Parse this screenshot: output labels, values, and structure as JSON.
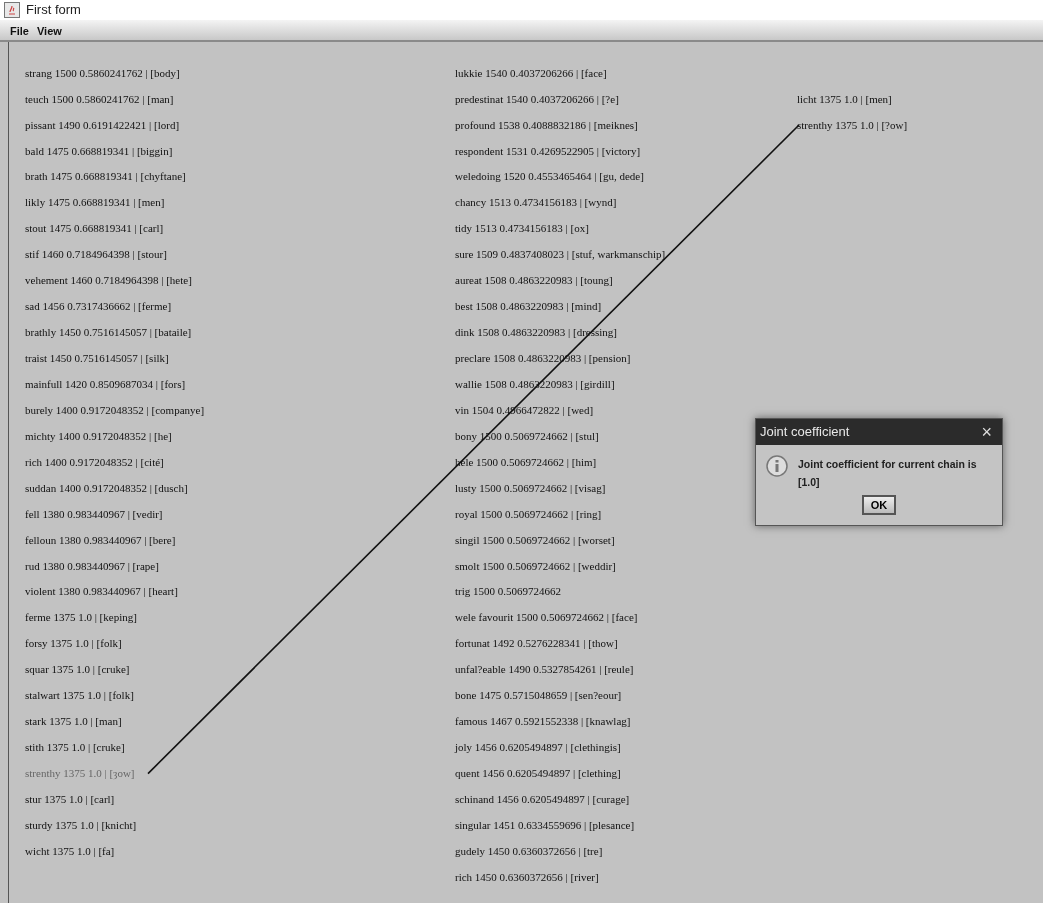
{
  "window": {
    "title": "First form"
  },
  "menu": [
    "File",
    "View"
  ],
  "columns": [
    [
      {
        "text": "strang 1500 0.5860241762 | [body]",
        "highlighted": false,
        "linked": false
      },
      {
        "text": "teuch 1500 0.5860241762 | [man]",
        "highlighted": false,
        "linked": false
      },
      {
        "text": "pissant 1490 0.6191422421 | [lord]",
        "highlighted": false,
        "linked": false
      },
      {
        "text": "bald 1475 0.668819341 | [biggin]",
        "highlighted": false,
        "linked": false
      },
      {
        "text": "brath 1475 0.668819341 | [chyftane]",
        "highlighted": false,
        "linked": false
      },
      {
        "text": "likly 1475 0.668819341 | [men]",
        "highlighted": false,
        "linked": false
      },
      {
        "text": "stout 1475 0.668819341 | [carl]",
        "highlighted": false,
        "linked": false
      },
      {
        "text": "stif 1460 0.7184964398 | [stour]",
        "highlighted": false,
        "linked": false
      },
      {
        "text": "vehement 1460 0.7184964398 | [hete]",
        "highlighted": false,
        "linked": false
      },
      {
        "text": "sad 1456 0.7317436662 | [ferme]",
        "highlighted": false,
        "linked": false
      },
      {
        "text": "brathly 1450 0.7516145057 | [bataile]",
        "highlighted": false,
        "linked": false
      },
      {
        "text": "traist 1450 0.7516145057 | [silk]",
        "highlighted": false,
        "linked": false
      },
      {
        "text": "mainfull 1420 0.8509687034 | [fors]",
        "highlighted": false,
        "linked": false
      },
      {
        "text": "burely 1400 0.9172048352 | [companye]",
        "highlighted": false,
        "linked": false
      },
      {
        "text": "michty 1400 0.9172048352 | [he]",
        "highlighted": false,
        "linked": false
      },
      {
        "text": "rich 1400 0.9172048352 | [cité]",
        "highlighted": false,
        "linked": false
      },
      {
        "text": "suddan 1400 0.9172048352 | [dusch]",
        "highlighted": false,
        "linked": false
      },
      {
        "text": "fell 1380 0.983440967 | [vedir]",
        "highlighted": false,
        "linked": false
      },
      {
        "text": "felloun 1380 0.983440967 | [bere]",
        "highlighted": false,
        "linked": false
      },
      {
        "text": "rud 1380 0.983440967 | [rape]",
        "highlighted": false,
        "linked": false
      },
      {
        "text": "violent 1380 0.983440967 | [heart]",
        "highlighted": false,
        "linked": false
      },
      {
        "text": "ferme 1375 1.0 | [keping]",
        "highlighted": false,
        "linked": false
      },
      {
        "text": "forsy 1375 1.0 | [folk]",
        "highlighted": false,
        "linked": false
      },
      {
        "text": "squar 1375 1.0 | [cruke]",
        "highlighted": false,
        "linked": false
      },
      {
        "text": "stalwart 1375 1.0 | [folk]",
        "highlighted": false,
        "linked": false
      },
      {
        "text": "stark 1375 1.0 | [man]",
        "highlighted": false,
        "linked": false
      },
      {
        "text": "stith 1375 1.0 | [cruke]",
        "highlighted": false,
        "linked": false
      },
      {
        "text": "strenthy 1375 1.0 | [ȝow]",
        "highlighted": true,
        "linked": true
      },
      {
        "text": "stur 1375 1.0 | [carl]",
        "highlighted": false,
        "linked": false
      },
      {
        "text": "sturdy 1375 1.0 | [knicht]",
        "highlighted": false,
        "linked": false
      },
      {
        "text": "wicht 1375 1.0 | [fa]",
        "highlighted": false,
        "linked": false
      }
    ],
    [
      {
        "text": "lukkie 1540 0.4037206266 | [face]",
        "highlighted": false,
        "linked": false
      },
      {
        "text": "predestinat 1540 0.4037206266 | [?e]",
        "highlighted": false,
        "linked": false
      },
      {
        "text": "profound 1538 0.4088832186 | [meiknes]",
        "highlighted": false,
        "linked": false
      },
      {
        "text": "respondent 1531 0.4269522905 | [victory]",
        "highlighted": false,
        "linked": false
      },
      {
        "text": "weledoing 1520 0.4553465464 | [gu, dede]",
        "highlighted": false,
        "linked": false
      },
      {
        "text": "chancy 1513 0.4734156183 | [wynd]",
        "highlighted": false,
        "linked": false
      },
      {
        "text": "tidy 1513 0.4734156183 | [ox]",
        "highlighted": false,
        "linked": false
      },
      {
        "text": "sure 1509 0.4837408023 | [stuf, warkmanschip]",
        "highlighted": false,
        "linked": false
      },
      {
        "text": "aureat 1508 0.4863220983 | [toung]",
        "highlighted": false,
        "linked": false
      },
      {
        "text": "best 1508 0.4863220983 | [mind]",
        "highlighted": false,
        "linked": false
      },
      {
        "text": "dink 1508 0.4863220983 | [dressing]",
        "highlighted": false,
        "linked": false
      },
      {
        "text": "preclare 1508 0.4863220983 | [pension]",
        "highlighted": false,
        "linked": false
      },
      {
        "text": "wallie 1508 0.4863220983 | [girdill]",
        "highlighted": false,
        "linked": false
      },
      {
        "text": "vin 1504 0.4966472822 | [wed]",
        "highlighted": false,
        "linked": false
      },
      {
        "text": "bony 1500 0.5069724662 | [stul]",
        "highlighted": false,
        "linked": false
      },
      {
        "text": "hele 1500 0.5069724662 | [him]",
        "highlighted": false,
        "linked": false
      },
      {
        "text": "lusty 1500 0.5069724662 | [visag]",
        "highlighted": false,
        "linked": false
      },
      {
        "text": "royal 1500 0.5069724662 | [ring]",
        "highlighted": false,
        "linked": false
      },
      {
        "text": "singil 1500 0.5069724662 | [worset]",
        "highlighted": false,
        "linked": false
      },
      {
        "text": "smolt 1500 0.5069724662 | [weddir]",
        "highlighted": false,
        "linked": false
      },
      {
        "text": "trig 1500 0.5069724662",
        "highlighted": false,
        "linked": false
      },
      {
        "text": "wele favourit 1500 0.5069724662 | [face]",
        "highlighted": false,
        "linked": false
      },
      {
        "text": "fortunat 1492 0.5276228341 | [thow]",
        "highlighted": false,
        "linked": false
      },
      {
        "text": "unfal?eable 1490 0.5327854261 | [reule]",
        "highlighted": false,
        "linked": false
      },
      {
        "text": "bone 1475 0.5715048659 | [sen?eour]",
        "highlighted": false,
        "linked": false
      },
      {
        "text": "famous 1467 0.5921552338 | [knawlag]",
        "highlighted": false,
        "linked": false
      },
      {
        "text": "joly 1456 0.6205494897 | [clethingis]",
        "highlighted": false,
        "linked": false
      },
      {
        "text": "quent 1456 0.6205494897 | [clething]",
        "highlighted": false,
        "linked": false
      },
      {
        "text": "schinand 1456 0.6205494897 | [curage]",
        "highlighted": false,
        "linked": false
      },
      {
        "text": "singular 1451 0.6334559696 | [plesance]",
        "highlighted": false,
        "linked": false
      },
      {
        "text": "gudely 1450 0.6360372656 | [tre]",
        "highlighted": false,
        "linked": false
      },
      {
        "text": "rich 1450 0.6360372656 | [river]",
        "highlighted": false,
        "linked": false
      }
    ],
    [
      {
        "text": "licht 1375 1.0 | [men]",
        "highlighted": false,
        "linked": false
      },
      {
        "text": "strenthy 1375 1.0 | [?ow]",
        "highlighted": false,
        "linked": true
      }
    ]
  ],
  "dialog": {
    "title": "Joint coefficient",
    "close": "×",
    "message": "Joint coefficient for current chain is [1.0]",
    "button": "OK"
  }
}
